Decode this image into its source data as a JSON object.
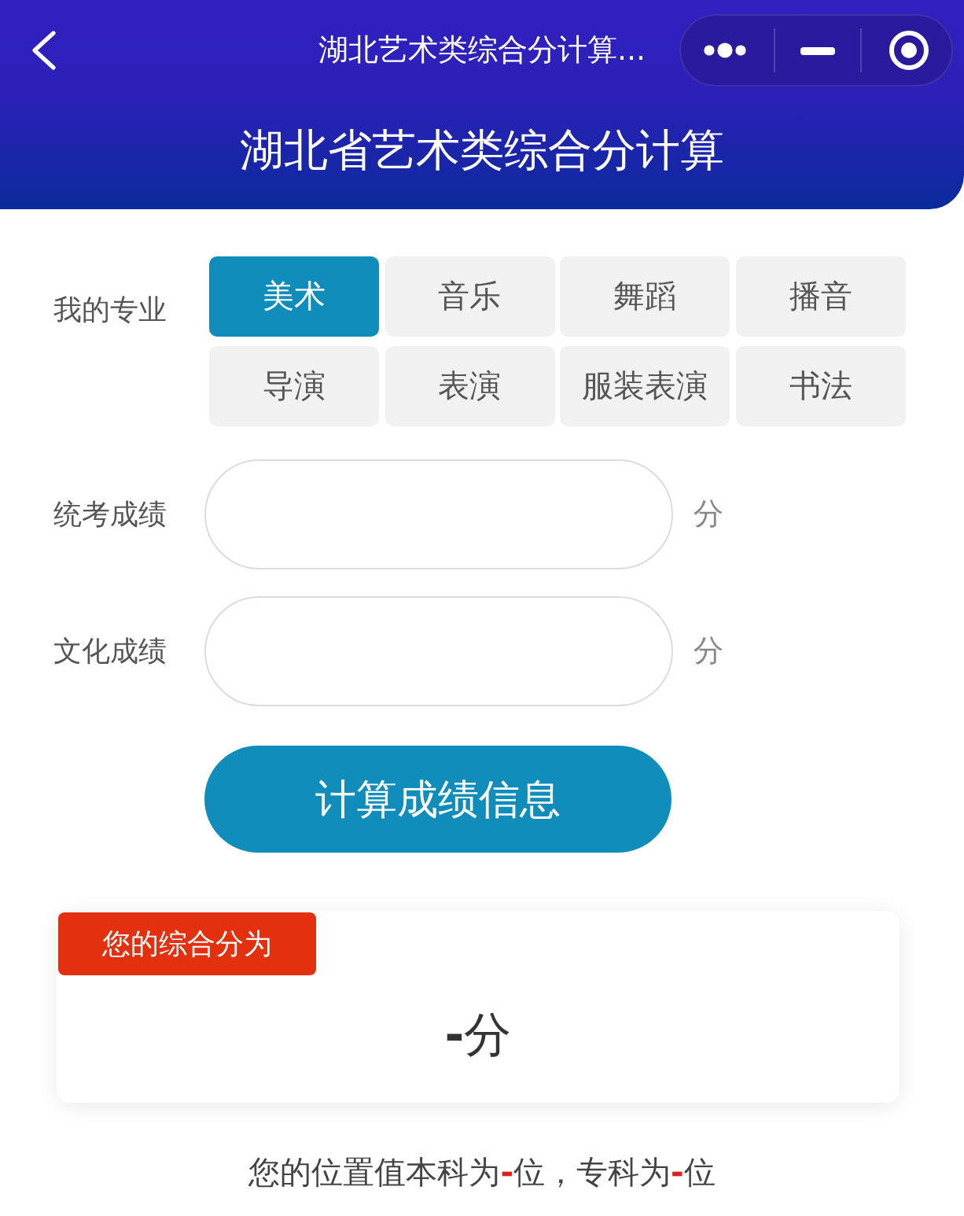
{
  "nav_bar": {
    "title": "湖北艺术类综合分计算..."
  },
  "header": {
    "title": "湖北省艺术类综合分计算"
  },
  "major": {
    "label": "我的专业",
    "options": [
      {
        "label": "美术",
        "selected": true
      },
      {
        "label": "音乐",
        "selected": false
      },
      {
        "label": "舞蹈",
        "selected": false
      },
      {
        "label": "播音",
        "selected": false
      },
      {
        "label": "导演",
        "selected": false
      },
      {
        "label": "表演",
        "selected": false
      },
      {
        "label": "服装表演",
        "selected": false
      },
      {
        "label": "书法",
        "selected": false
      }
    ]
  },
  "score_fields": [
    {
      "label": "统考成绩",
      "unit": "分"
    },
    {
      "label": "文化成绩",
      "unit": "分"
    }
  ],
  "calculate_button": {
    "label": "计算成绩信息"
  },
  "result": {
    "badge": "您的综合分为",
    "score": "-",
    "unit": "分"
  },
  "rank_line": {
    "segments": [
      {
        "kind": "text",
        "text": "您的位置值本科为"
      },
      {
        "kind": "value",
        "text": "-"
      },
      {
        "kind": "text",
        "text": "位，专科为"
      },
      {
        "kind": "value",
        "text": "-"
      },
      {
        "kind": "text",
        "text": "位"
      }
    ]
  }
}
